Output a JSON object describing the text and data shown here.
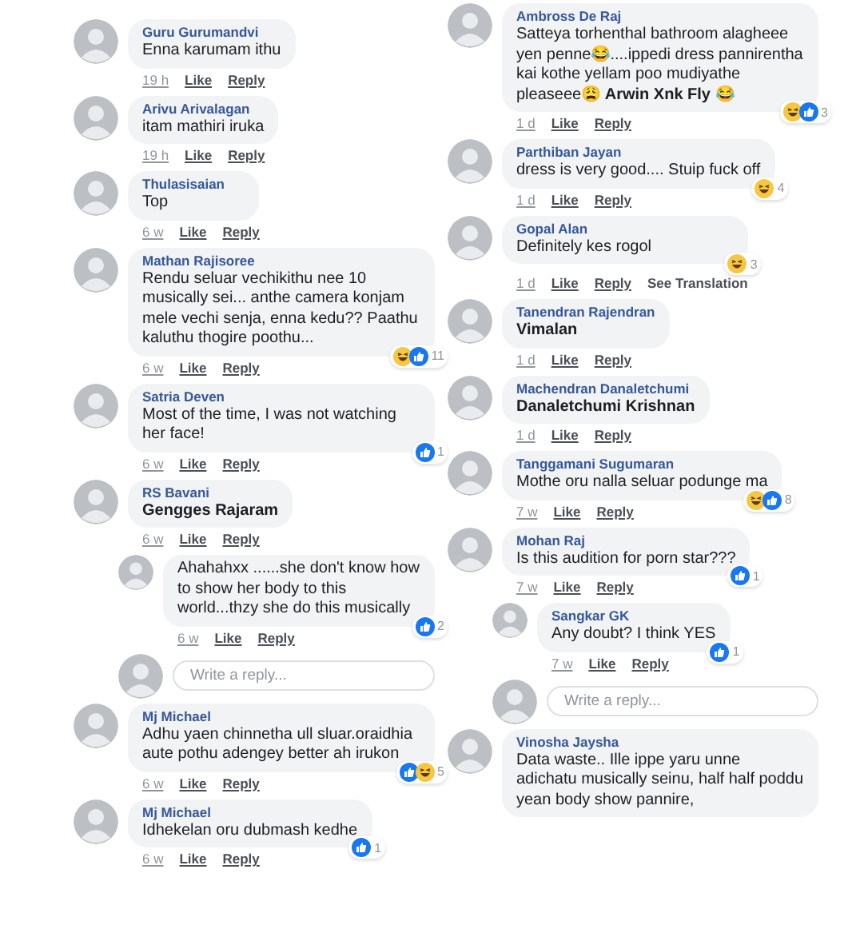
{
  "columns": [
    {
      "items": [
        {
          "kind": "comment",
          "reply": false,
          "name": "Guru Gurumandvi",
          "text": "Enna karumam ithu",
          "time": "19 h",
          "like": "Like",
          "reply_link": "Reply"
        },
        {
          "kind": "comment",
          "reply": false,
          "name": "Arivu Arivalagan",
          "text": "itam mathiri iruka",
          "time": "19 h",
          "like": "Like",
          "reply_link": "Reply"
        },
        {
          "kind": "comment",
          "reply": false,
          "name": "Thulasisaian",
          "text": "Top",
          "time": "6 w",
          "like": "Like",
          "reply_link": "Reply"
        },
        {
          "kind": "comment",
          "reply": false,
          "name": "Mathan Rajisoree",
          "text": "Rendu seluar vechikithu nee 10 musically sei... anthe camera konjam mele vechi senja, enna kedu?? Paathu kaluthu thogire poothu...",
          "time": "6 w",
          "like": "Like",
          "reply_link": "Reply",
          "reactions": {
            "icons": [
              {
                "kind": "haha"
              },
              {
                "kind": "like"
              }
            ],
            "count": "11"
          }
        },
        {
          "kind": "comment",
          "reply": false,
          "name": "Satria Deven",
          "text": "Most of the time, I was not watching her face!",
          "time": "6 w",
          "like": "Like",
          "reply_link": "Reply",
          "reactions": {
            "icons": [
              {
                "kind": "like"
              }
            ],
            "count": "1"
          }
        },
        {
          "kind": "comment",
          "reply": false,
          "name": "RS Bavani",
          "text": "**Gengges Rajaram**",
          "time": "6 w",
          "like": "Like",
          "reply_link": "Reply"
        },
        {
          "kind": "comment",
          "reply": true,
          "text": "Ahahahxx  ......she don't know how to show her body to this world...thzy she do this musically",
          "time": "6 w",
          "like": "Like",
          "reply_link": "Reply",
          "reactions": {
            "icons": [
              {
                "kind": "like"
              }
            ],
            "count": "2"
          }
        },
        {
          "kind": "reply_box",
          "placeholder": "Write a reply..."
        },
        {
          "kind": "comment",
          "reply": false,
          "name": "Mj Michael",
          "text": "Adhu yaen chinnetha ull sluar.oraidhia aute pothu adengey better ah irukon",
          "time": "6 w",
          "like": "Like",
          "reply_link": "Reply",
          "reactions": {
            "icons": [
              {
                "kind": "like"
              },
              {
                "kind": "haha"
              }
            ],
            "count": "5"
          }
        },
        {
          "kind": "comment",
          "reply": false,
          "name": "Mj Michael",
          "text": "Idhekelan oru dubmash kedhe",
          "time": "6 w",
          "like": "Like",
          "reply_link": "Reply",
          "reactions": {
            "icons": [
              {
                "kind": "like"
              }
            ],
            "count": "1"
          }
        }
      ]
    },
    {
      "items": [
        {
          "kind": "comment",
          "reply": false,
          "name": "Ambross De Raj",
          "text": "Satteya torhenthal bathroom alagheee yen penne😂....ippedi dress pannirentha kai kothe yellam poo mudiyathe pleaseee😩 **Arwin Xnk Fly** 😂",
          "time": "1 d",
          "like": "Like",
          "reply_link": "Reply",
          "reactions": {
            "icons": [
              {
                "kind": "haha"
              },
              {
                "kind": "like"
              }
            ],
            "count": "3"
          }
        },
        {
          "kind": "comment",
          "reply": false,
          "name": "Parthiban Jayan",
          "text": "dress is very good.... Stuip fuck off",
          "time": "1 d",
          "like": "Like",
          "reply_link": "Reply",
          "reactions": {
            "icons": [
              {
                "kind": "haha"
              }
            ],
            "count": "4"
          }
        },
        {
          "kind": "comment",
          "reply": false,
          "name": "Gopal Alan",
          "text": "Definitely kes rogol",
          "time": "1 d",
          "like": "Like",
          "reply_link": "Reply",
          "translate": "See Translation",
          "reactions": {
            "icons": [
              {
                "kind": "haha"
              }
            ],
            "count": "3"
          }
        },
        {
          "kind": "comment",
          "reply": false,
          "name": "Tanendran Rajendran",
          "text": "**Vimalan**",
          "time": "1 d",
          "like": "Like",
          "reply_link": "Reply"
        },
        {
          "kind": "comment",
          "reply": false,
          "name": "Machendran Danaletchumi",
          "text": "**Danaletchumi Krishnan**",
          "time": "1 d",
          "like": "Like",
          "reply_link": "Reply"
        },
        {
          "kind": "comment",
          "reply": false,
          "name": "Tanggamani Sugumaran",
          "text": "Mothe oru nalla seluar podunge ma",
          "time": "7 w",
          "like": "Like",
          "reply_link": "Reply",
          "reactions": {
            "icons": [
              {
                "kind": "haha"
              },
              {
                "kind": "like"
              }
            ],
            "count": "8"
          }
        },
        {
          "kind": "comment",
          "reply": false,
          "name": "Mohan Raj",
          "text": "Is this audition for porn star???",
          "time": "7 w",
          "like": "Like",
          "reply_link": "Reply",
          "reactions": {
            "icons": [
              {
                "kind": "like"
              }
            ],
            "count": "1"
          }
        },
        {
          "kind": "comment",
          "reply": true,
          "name": "Sangkar GK",
          "text": "Any doubt? I think YES",
          "time": "7 w",
          "like": "Like",
          "reply_link": "Reply",
          "reactions": {
            "icons": [
              {
                "kind": "like"
              }
            ],
            "count": "1"
          }
        },
        {
          "kind": "reply_box",
          "placeholder": "Write a reply..."
        },
        {
          "kind": "comment",
          "reply": false,
          "name": "Vinosha Jaysha",
          "text": "Data waste..  Ille ippe yaru unne adichatu musically seinu, half half poddu yean body show pannire,"
        }
      ]
    }
  ]
}
